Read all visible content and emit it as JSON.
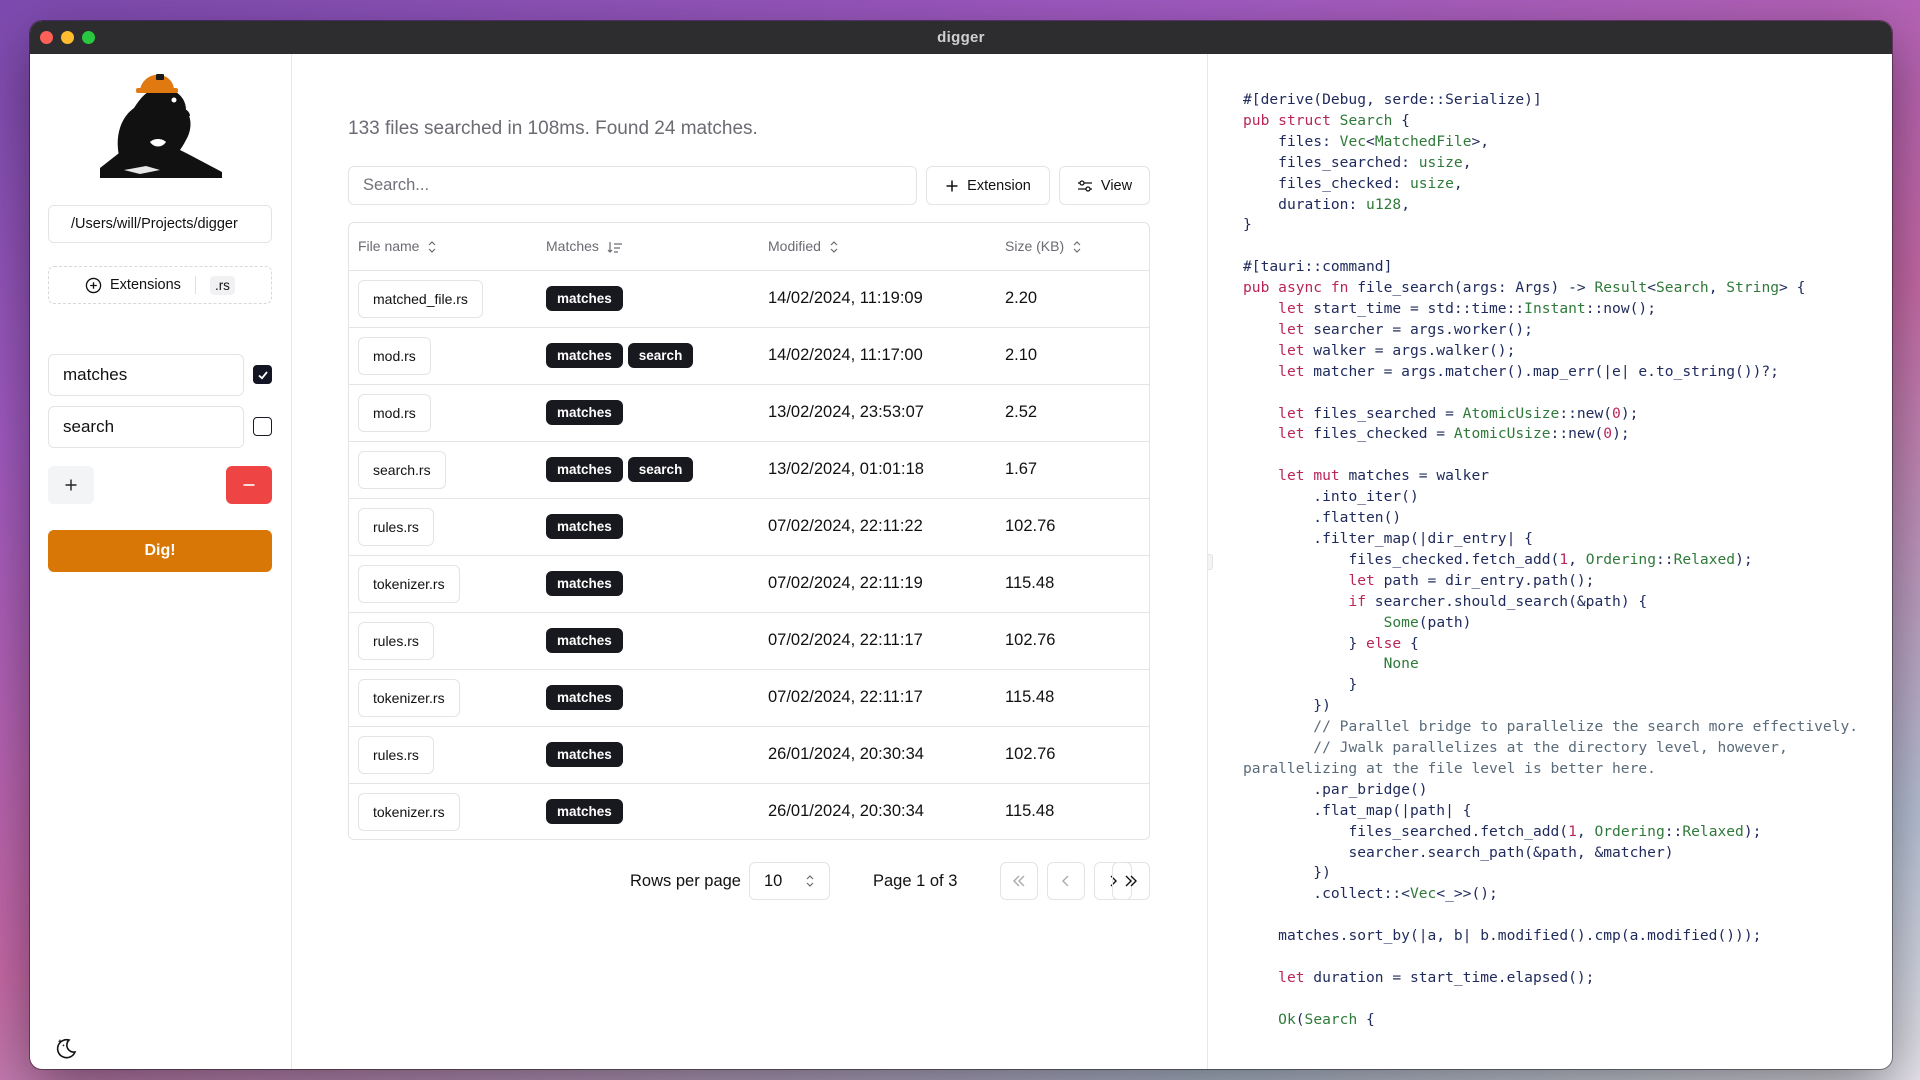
{
  "window": {
    "title": "digger"
  },
  "sidebar": {
    "path": "/Users/will/Projects/digger",
    "extensions_label": "Extensions",
    "extension_value": ".rs",
    "terms": [
      {
        "value": "matches",
        "checked": true
      },
      {
        "value": "search",
        "checked": false
      }
    ],
    "add_label": "+",
    "remove_label": "−",
    "dig_label": "Dig!",
    "accent_color": "#d97706",
    "danger_color": "#ef4444"
  },
  "main": {
    "summary": "133 files searched in 108ms. Found 24 matches.",
    "search_placeholder": "Search...",
    "extension_button": "Extension",
    "view_button": "View",
    "columns": [
      "File name",
      "Matches",
      "Modified",
      "Size (KB)"
    ],
    "rows": [
      {
        "file": "matched_file.rs",
        "matches": [
          "matches"
        ],
        "modified": "14/02/2024, 11:19:09",
        "size": "2.20"
      },
      {
        "file": "mod.rs",
        "matches": [
          "matches",
          "search"
        ],
        "modified": "14/02/2024, 11:17:00",
        "size": "2.10"
      },
      {
        "file": "mod.rs",
        "matches": [
          "matches"
        ],
        "modified": "13/02/2024, 23:53:07",
        "size": "2.52"
      },
      {
        "file": "search.rs",
        "matches": [
          "matches",
          "search"
        ],
        "modified": "13/02/2024, 01:01:18",
        "size": "1.67"
      },
      {
        "file": "rules.rs",
        "matches": [
          "matches"
        ],
        "modified": "07/02/2024, 22:11:22",
        "size": "102.76"
      },
      {
        "file": "tokenizer.rs",
        "matches": [
          "matches"
        ],
        "modified": "07/02/2024, 22:11:19",
        "size": "115.48"
      },
      {
        "file": "rules.rs",
        "matches": [
          "matches"
        ],
        "modified": "07/02/2024, 22:11:17",
        "size": "102.76"
      },
      {
        "file": "tokenizer.rs",
        "matches": [
          "matches"
        ],
        "modified": "07/02/2024, 22:11:17",
        "size": "115.48"
      },
      {
        "file": "rules.rs",
        "matches": [
          "matches"
        ],
        "modified": "26/01/2024, 20:30:34",
        "size": "102.76"
      },
      {
        "file": "tokenizer.rs",
        "matches": [
          "matches"
        ],
        "modified": "26/01/2024, 20:30:34",
        "size": "115.48"
      }
    ],
    "pagination": {
      "rows_per_page_label": "Rows per page",
      "rows_per_page": "10",
      "page_label": "Page 1 of 3"
    }
  },
  "code": {
    "lines": [
      "#[derive(Debug, serde::Serialize)]",
      "pub struct Search {",
      "    files: Vec<MatchedFile>,",
      "    files_searched: usize,",
      "    files_checked: usize,",
      "    duration: u128,",
      "}",
      "",
      "#[tauri::command]",
      "pub async fn file_search(args: Args) -> Result<Search, String> {",
      "    let start_time = std::time::Instant::now();",
      "    let searcher = args.worker();",
      "    let walker = args.walker();",
      "    let matcher = args.matcher().map_err(|e| e.to_string())?;",
      "",
      "    let files_searched = AtomicUsize::new(0);",
      "    let files_checked = AtomicUsize::new(0);",
      "",
      "    let mut matches = walker",
      "        .into_iter()",
      "        .flatten()",
      "        .filter_map(|dir_entry| {",
      "            files_checked.fetch_add(1, Ordering::Relaxed);",
      "            let path = dir_entry.path();",
      "            if searcher.should_search(&path) {",
      "                Some(path)",
      "            } else {",
      "                None",
      "            }",
      "        })",
      "        // Parallel bridge to parallelize the search more effectively.",
      "        // Jwalk parallelizes at the directory level, however, parallelizing at the file level is better here.",
      "        .par_bridge()",
      "        .flat_map(|path| {",
      "            files_searched.fetch_add(1, Ordering::Relaxed);",
      "            searcher.search_path(&path, &matcher)",
      "        })",
      "        .collect::<Vec<_>>();",
      "",
      "    matches.sort_by(|a, b| b.modified().cmp(a.modified()));",
      "",
      "    let duration = start_time.elapsed();",
      "",
      "    Ok(Search {"
    ]
  }
}
